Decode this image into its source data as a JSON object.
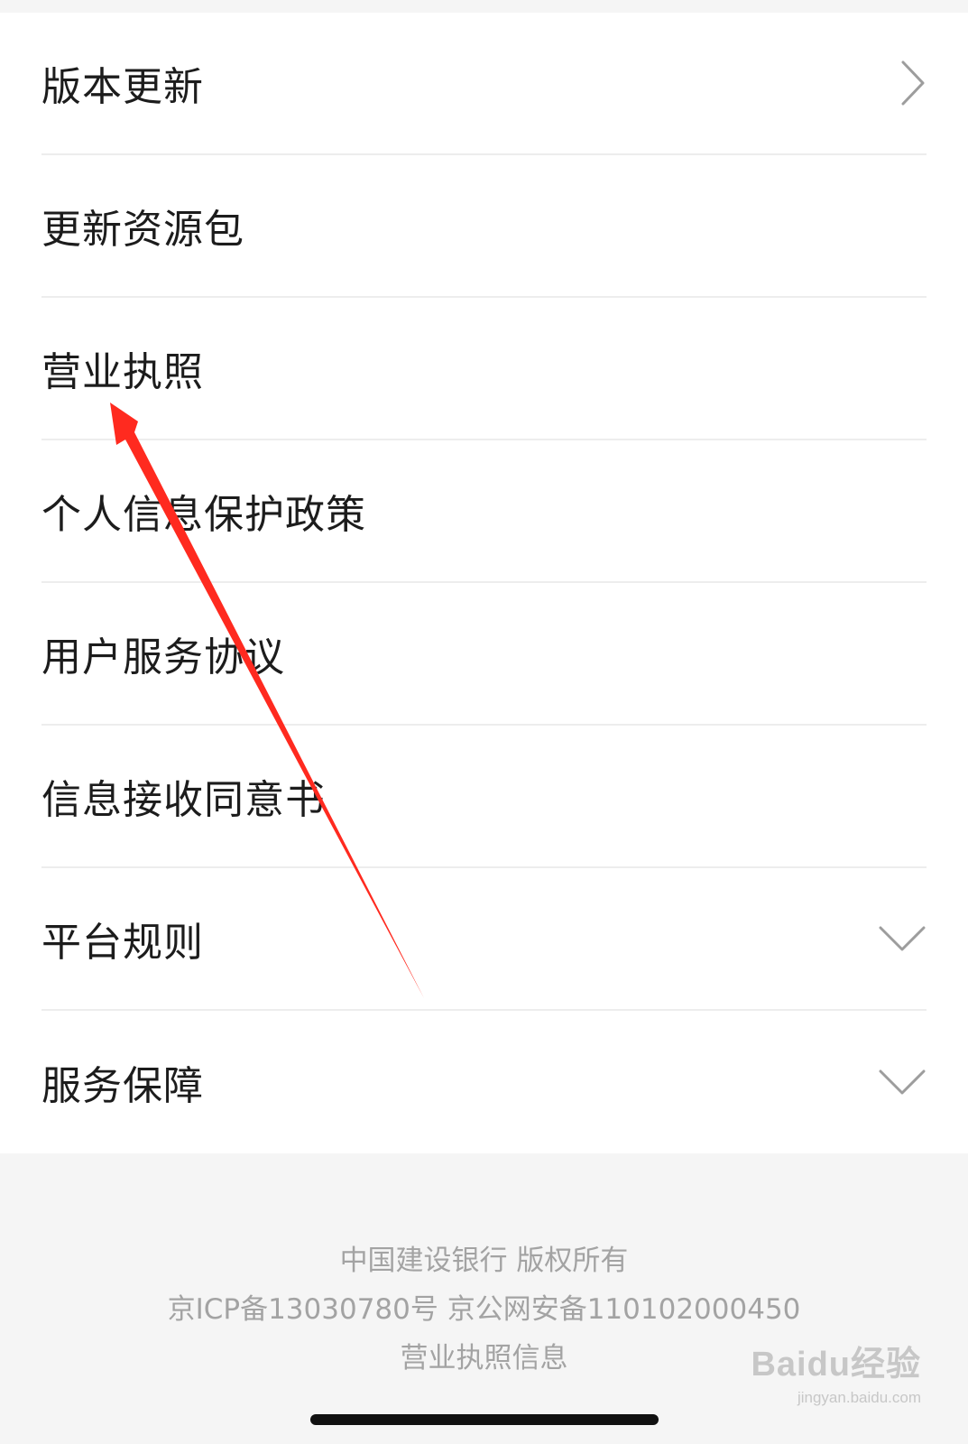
{
  "menu": {
    "items": [
      {
        "label": "版本更新",
        "icon": "chevron-right-icon"
      },
      {
        "label": "更新资源包",
        "icon": ""
      },
      {
        "label": "营业执照",
        "icon": ""
      },
      {
        "label": "个人信息保护政策",
        "icon": ""
      },
      {
        "label": "用户服务协议",
        "icon": ""
      },
      {
        "label": "信息接收同意书",
        "icon": ""
      },
      {
        "label": "平台规则",
        "icon": "chevron-down-icon"
      },
      {
        "label": "服务保障",
        "icon": "chevron-down-icon"
      }
    ]
  },
  "footer": {
    "copyright": "中国建设银行 版权所有",
    "icp": "京ICP备13030780号 京公网安备110102000450",
    "license_link": "营业执照信息"
  },
  "watermark": {
    "brand": "Baidu经验",
    "url": "jingyan.baidu.com"
  },
  "colors": {
    "annotation_arrow": "#ff2a1f",
    "background": "#f5f5f5",
    "list_background": "#ffffff",
    "label_text": "#1c1c1c",
    "footer_text": "#a3a3a3"
  }
}
